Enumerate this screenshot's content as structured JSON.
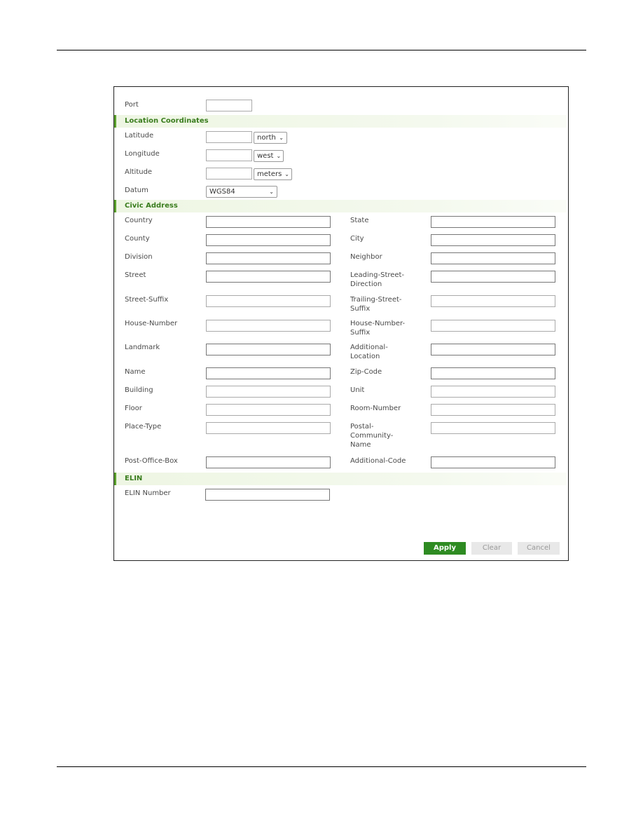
{
  "port": {
    "label": "Port",
    "value": ""
  },
  "sections": {
    "location": "Location Coordinates",
    "civic": "Civic Address",
    "elin": "ELIN"
  },
  "location": {
    "latitude": {
      "label": "Latitude",
      "value": "",
      "unit": "north"
    },
    "longitude": {
      "label": "Longitude",
      "value": "",
      "unit": "west"
    },
    "altitude": {
      "label": "Altitude",
      "value": "",
      "unit": "meters"
    },
    "datum": {
      "label": "Datum",
      "value": "WGS84"
    }
  },
  "civic": {
    "left": [
      {
        "label": "Country",
        "value": ""
      },
      {
        "label": "County",
        "value": ""
      },
      {
        "label": "Division",
        "value": ""
      },
      {
        "label": "Street",
        "value": ""
      },
      {
        "label": "Street-Suffix",
        "value": ""
      },
      {
        "label": "House-Number",
        "value": ""
      },
      {
        "label": "Landmark",
        "value": ""
      },
      {
        "label": "Name",
        "value": ""
      },
      {
        "label": "Building",
        "value": ""
      },
      {
        "label": "Floor",
        "value": ""
      },
      {
        "label": "Place-Type",
        "value": ""
      },
      {
        "label": "Post-Office-Box",
        "value": ""
      }
    ],
    "right": [
      {
        "label": "State",
        "value": ""
      },
      {
        "label": "City",
        "value": ""
      },
      {
        "label": "Neighbor",
        "value": ""
      },
      {
        "label": "Leading-Street-Direction",
        "value": ""
      },
      {
        "label": "Trailing-Street-Suffix",
        "value": ""
      },
      {
        "label": "House-Number-Suffix",
        "value": ""
      },
      {
        "label": "Additional-Location",
        "value": ""
      },
      {
        "label": "Zip-Code",
        "value": ""
      },
      {
        "label": "Unit",
        "value": ""
      },
      {
        "label": "Room-Number",
        "value": ""
      },
      {
        "label": "Postal-Community-Name",
        "value": ""
      },
      {
        "label": "Additional-Code",
        "value": ""
      }
    ]
  },
  "elin": {
    "label": "ELIN Number",
    "value": ""
  },
  "buttons": {
    "apply": "Apply",
    "clear": "Clear",
    "cancel": "Cancel"
  },
  "icons": {
    "chevron": "⌄"
  },
  "colors": {
    "accent": "#3a7d1e",
    "apply_bg": "#2e8b22",
    "section_bar": "#5aa02c"
  }
}
